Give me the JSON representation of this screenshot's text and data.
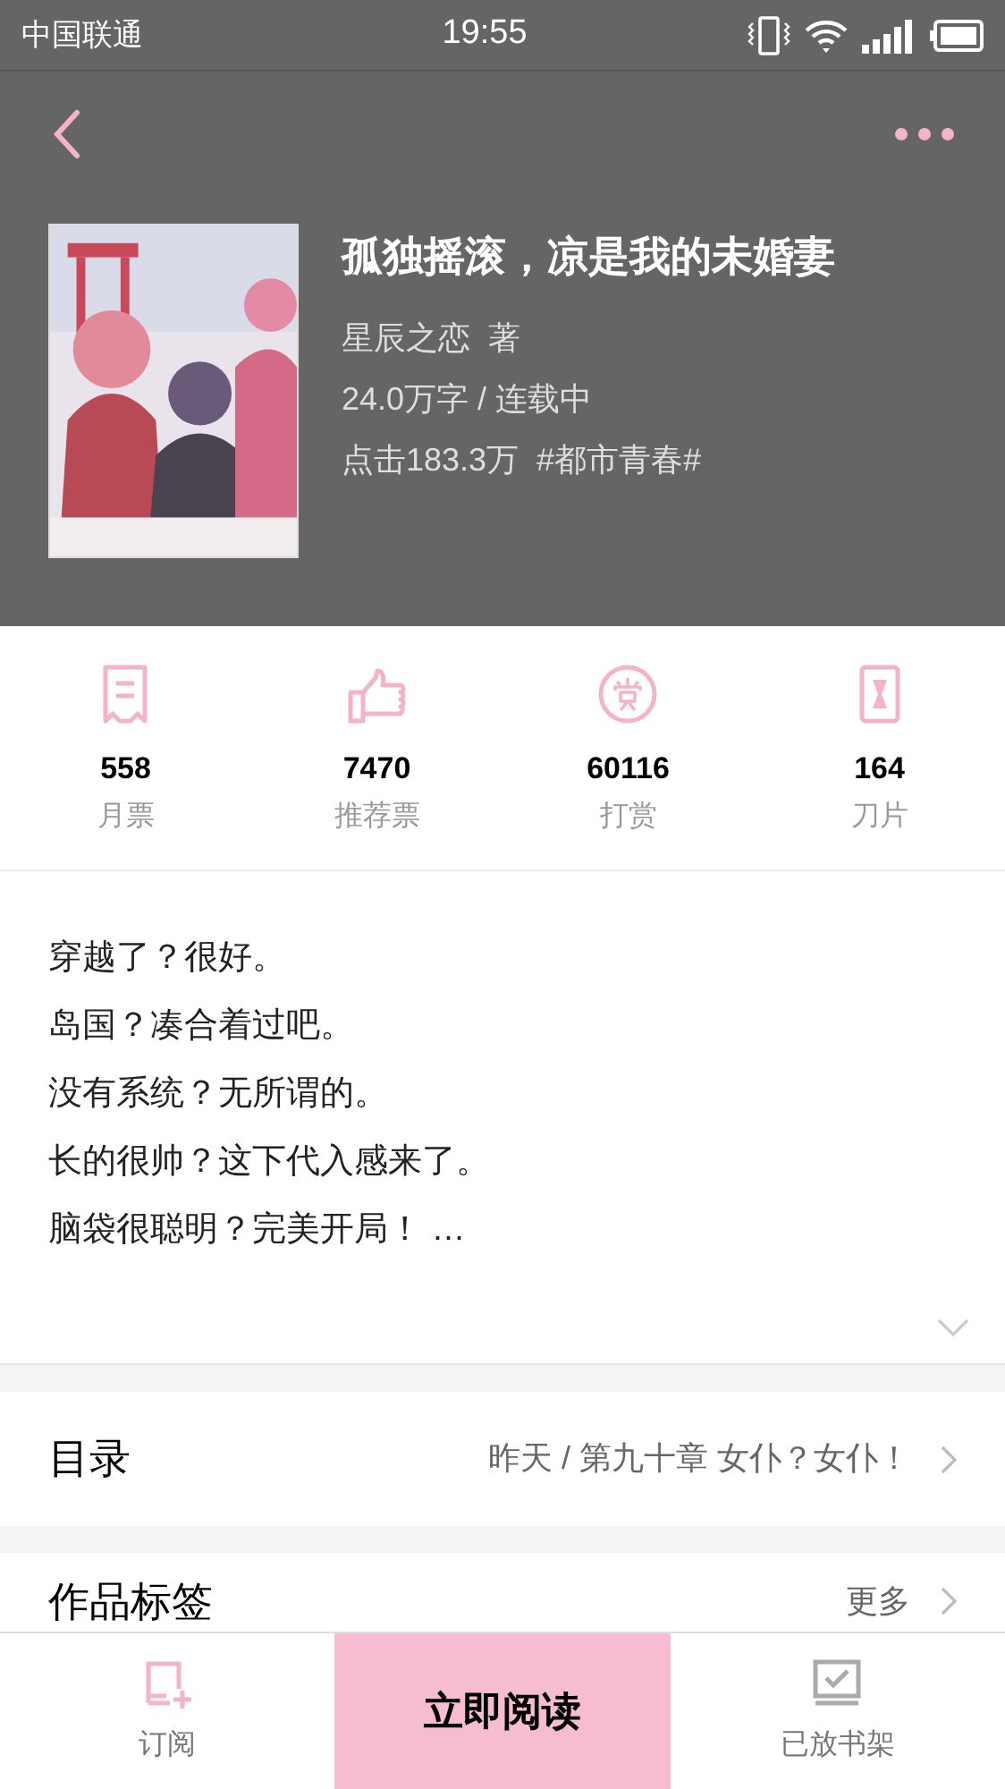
{
  "status_bar": {
    "carrier": "中国联通",
    "time": "19:55"
  },
  "book": {
    "title": "孤独摇滚，凉是我的未婚妻",
    "author": "星辰之恋  著",
    "info": "24.0万字 / 连载中",
    "stats": "点击183.3万  #都市青春#"
  },
  "stats": [
    {
      "kind": "ticket",
      "value": "558",
      "label": "月票"
    },
    {
      "kind": "thumb",
      "value": "7470",
      "label": "推荐票"
    },
    {
      "kind": "reward",
      "value": "60116",
      "label": "打赏"
    },
    {
      "kind": "blade",
      "value": "164",
      "label": "刀片"
    }
  ],
  "synopsis": {
    "lines": [
      "穿越了？很好。",
      "岛国？凑合着过吧。",
      "没有系统？无所谓的。",
      "长的很帅？这下代入感来了。",
      "脑袋很聪明？完美开局！ …"
    ],
    "expanded": false
  },
  "catalog": {
    "title": "目录",
    "latest": "昨天 / 第九十章 女仆？女仆！"
  },
  "tags": {
    "title": "作品标签",
    "more": "更多"
  },
  "bottom_bar": [
    {
      "kind": "subscribe",
      "label": "订阅"
    },
    {
      "kind": "read",
      "label": "立即阅读"
    },
    {
      "kind": "shelf",
      "label": "已放书架"
    }
  ]
}
